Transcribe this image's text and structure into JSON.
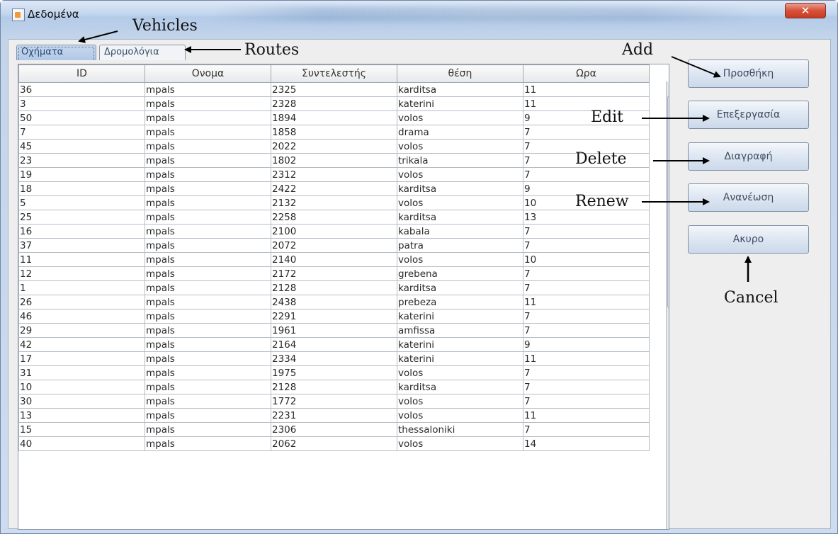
{
  "window": {
    "title": "Δεδομένα",
    "close_glyph": "✕"
  },
  "tabs": [
    {
      "label": "Οχήματα"
    },
    {
      "label": "Δρομολόγια"
    }
  ],
  "table": {
    "columns": [
      "ID",
      "Ονομα",
      "Συντελεστής",
      "θέση",
      "Ωρα"
    ],
    "rows": [
      [
        "36",
        "mpals",
        "2325",
        "karditsa",
        "11"
      ],
      [
        "3",
        "mpals",
        "2328",
        "katerini",
        "11"
      ],
      [
        "50",
        "mpals",
        "1894",
        "volos",
        "9"
      ],
      [
        "7",
        "mpals",
        "1858",
        "drama",
        "7"
      ],
      [
        "45",
        "mpals",
        "2022",
        "volos",
        "7"
      ],
      [
        "23",
        "mpals",
        "1802",
        "trikala",
        "7"
      ],
      [
        "19",
        "mpals",
        "2312",
        "volos",
        "7"
      ],
      [
        "18",
        "mpals",
        "2422",
        "karditsa",
        "9"
      ],
      [
        "5",
        "mpals",
        "2132",
        "volos",
        "10"
      ],
      [
        "25",
        "mpals",
        "2258",
        "karditsa",
        "13"
      ],
      [
        "16",
        "mpals",
        "2100",
        "kabala",
        "7"
      ],
      [
        "37",
        "mpals",
        "2072",
        "patra",
        "7"
      ],
      [
        "11",
        "mpals",
        "2140",
        "volos",
        "10"
      ],
      [
        "12",
        "mpals",
        "2172",
        "grebena",
        "7"
      ],
      [
        "1",
        "mpals",
        "2128",
        "karditsa",
        "7"
      ],
      [
        "26",
        "mpals",
        "2438",
        "prebeza",
        "11"
      ],
      [
        "46",
        "mpals",
        "2291",
        "katerini",
        "7"
      ],
      [
        "29",
        "mpals",
        "1961",
        "amfissa",
        "7"
      ],
      [
        "42",
        "mpals",
        "2164",
        "katerini",
        "9"
      ],
      [
        "17",
        "mpals",
        "2334",
        "katerini",
        "11"
      ],
      [
        "31",
        "mpals",
        "1975",
        "volos",
        "7"
      ],
      [
        "10",
        "mpals",
        "2128",
        "karditsa",
        "7"
      ],
      [
        "30",
        "mpals",
        "1772",
        "volos",
        "7"
      ],
      [
        "13",
        "mpals",
        "2231",
        "volos",
        "11"
      ],
      [
        "15",
        "mpals",
        "2306",
        "thessaloniki",
        "7"
      ],
      [
        "40",
        "mpals",
        "2062",
        "volos",
        "14"
      ]
    ]
  },
  "buttons": {
    "add": "Προσθήκη",
    "edit": "Επεξεργασία",
    "delete": "Διαγραφή",
    "renew": "Ανανέωση",
    "cancel": "Ακυρο"
  },
  "annotations": {
    "vehicles": "Vehicles",
    "routes": "Routes",
    "add": "Add",
    "edit": "Edit",
    "delete": "Delete",
    "renew": "Renew",
    "cancel": "Cancel"
  },
  "icons": {
    "app": "app-window-icon",
    "close": "close-icon",
    "scroll_up": "scroll-up-arrow-icon",
    "scroll_down": "scroll-down-arrow-icon"
  }
}
